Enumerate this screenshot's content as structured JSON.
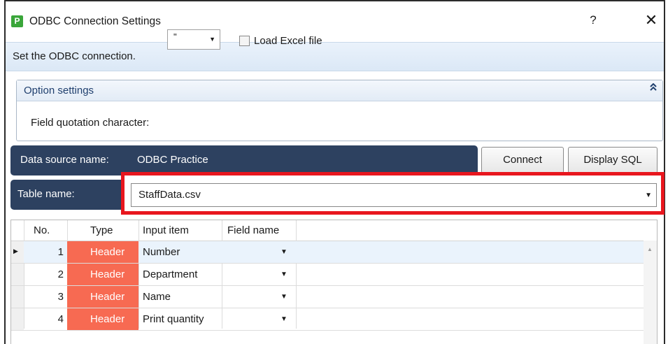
{
  "window": {
    "title": "ODBC Connection Settings",
    "app_icon": "P",
    "help": "?",
    "close": "✕"
  },
  "description": "Set the ODBC connection.",
  "options": {
    "title": "Option settings",
    "collapse_glyph": "⌃⌃",
    "field_quotation_label": "Field quotation character:",
    "field_quotation_value": "\"",
    "load_excel_label": "Load Excel file",
    "load_excel_checked": false
  },
  "datasource": {
    "label": "Data source name:",
    "value": "ODBC Practice"
  },
  "buttons": {
    "connect": "Connect",
    "display_sql": "Display SQL"
  },
  "table": {
    "label": "Table name:",
    "value": "StaffData.csv"
  },
  "grid": {
    "headers": {
      "no": "No.",
      "type": "Type",
      "input_item": "Input item",
      "field_name": "Field name"
    },
    "rows": [
      {
        "no": "1",
        "type": "Header",
        "input_item": "Number"
      },
      {
        "no": "2",
        "type": "Header",
        "input_item": "Department"
      },
      {
        "no": "3",
        "type": "Header",
        "input_item": "Name"
      },
      {
        "no": "4",
        "type": "Header",
        "input_item": "Print quantity"
      }
    ]
  },
  "colors": {
    "header_bar": "#2d4160",
    "type_cell": "#f76a52",
    "highlight": "#e8161e",
    "desc_bar": "#dbe8f6"
  }
}
